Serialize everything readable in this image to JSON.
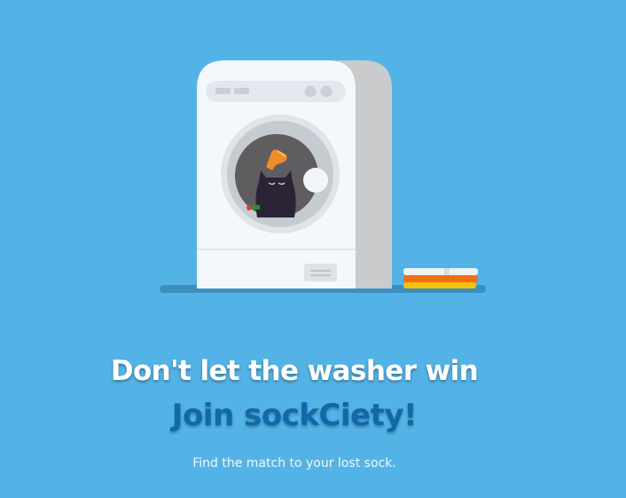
{
  "hero": {
    "illustration_label": "washing-machine-with-cat",
    "headline": "Don't let the washer win",
    "subheadline": "Join sockCiety!",
    "tagline": "Find the match to your lost sock."
  },
  "colors": {
    "background": "#54b3e6",
    "headline": "#ffffff",
    "subheadline": "#1069a8",
    "tagline": "#eef7fd"
  },
  "icons": {
    "washer": "washing-machine-icon",
    "cat": "cat-icon",
    "sock": "sock-icon",
    "towels": "folded-towels-icon"
  }
}
